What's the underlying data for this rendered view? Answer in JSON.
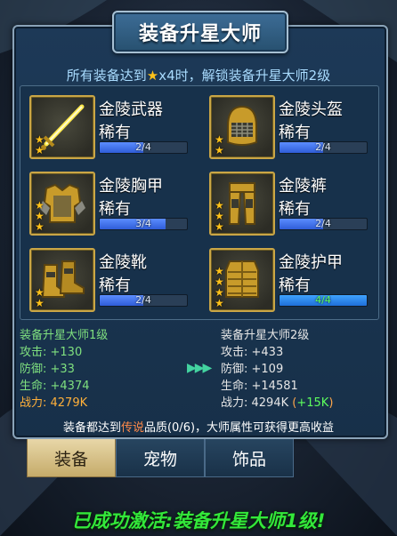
{
  "title": "装备升星大师",
  "unlock": {
    "prefix": "所有装备达到",
    "star": "★",
    "suffix": "x4时，解锁装备升星大师2级"
  },
  "items": [
    {
      "name": "金陵武器",
      "rarity": "稀有",
      "stars": 2,
      "progress": "2/4",
      "progress_value": 0.5,
      "icon": "sword-icon"
    },
    {
      "name": "金陵头盔",
      "rarity": "稀有",
      "stars": 2,
      "progress": "2/4",
      "progress_value": 0.5,
      "icon": "helmet-icon"
    },
    {
      "name": "金陵胸甲",
      "rarity": "稀有",
      "stars": 3,
      "progress": "3/4",
      "progress_value": 0.75,
      "icon": "chest-armor-icon"
    },
    {
      "name": "金陵裤",
      "rarity": "稀有",
      "stars": 3,
      "progress": "2/4",
      "progress_value": 0.5,
      "icon": "pants-icon"
    },
    {
      "name": "金陵靴",
      "rarity": "稀有",
      "stars": 2,
      "progress": "2/4",
      "progress_value": 0.5,
      "icon": "boots-icon"
    },
    {
      "name": "金陵护甲",
      "rarity": "稀有",
      "stars": 4,
      "progress": "4/4",
      "progress_value": 1.0,
      "icon": "armor-icon"
    }
  ],
  "current": {
    "header": "装备升星大师1级",
    "attack": "攻击: +130",
    "defense": "防御: +33",
    "hp": "生命: +4374",
    "power": "战力: 4279K"
  },
  "next": {
    "header": "装备升星大师2级",
    "attack": "攻击: +433",
    "defense": "防御: +109",
    "hp": "生命: +14581",
    "power": "战力: 4294K",
    "power_bonus_open": "(",
    "power_bonus": "+15K",
    "power_bonus_close": ")"
  },
  "arrows": "▶▶▶",
  "note": {
    "prefix": "装备都达到",
    "highlight": "传说",
    "suffix": "品质(0/6)，大师属性可获得更高收益"
  },
  "tabs": [
    "装备",
    "宠物",
    "饰品"
  ],
  "activated_message": "已成功激活:装备升星大师1级!",
  "colors": {
    "accent_gold": "#caa646",
    "star": "#ffc21a",
    "success_green": "#33e83a",
    "highlight_orange": "#ff8a4a"
  }
}
